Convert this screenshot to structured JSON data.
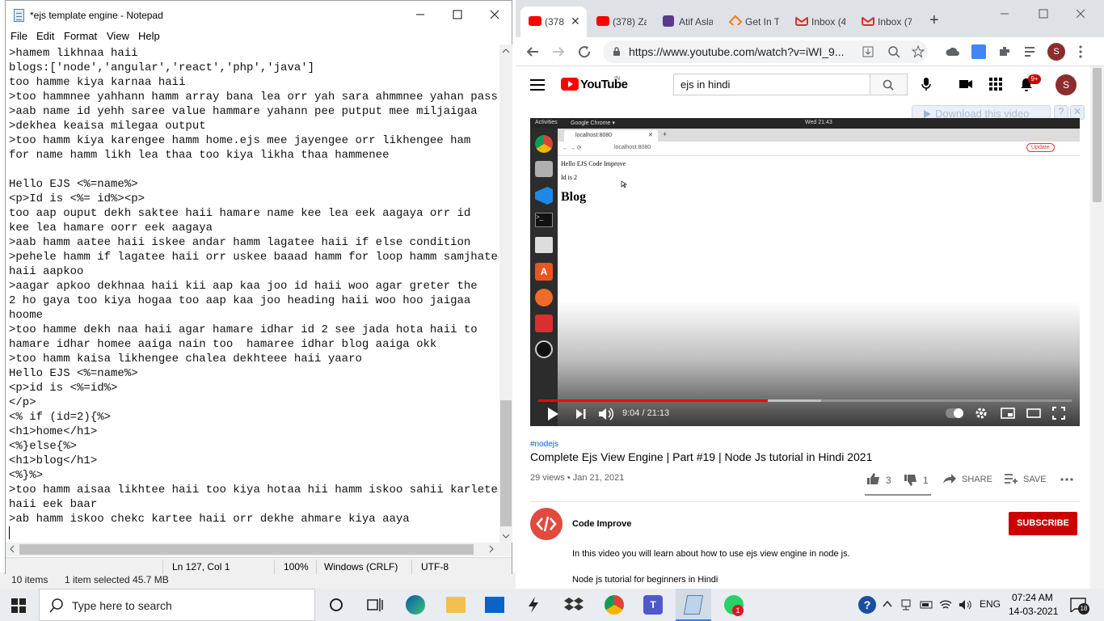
{
  "explorer": {
    "items": "10 items",
    "selected": "1 item selected  45.7 MB"
  },
  "notepad": {
    "title": "*ejs template engine - Notepad",
    "menu": [
      "File",
      "Edit",
      "Format",
      "View",
      "Help"
    ],
    "lines": [
      ">hamem likhnaa haii",
      "blogs:['node','angular','react','php','java']",
      "too hamme kiya karnaa haii",
      ">too hammnee yahhann hamm array bana lea orr yah sara ahmmnee yahan passkari",
      ">aab name id yehh saree value hammare yahann pee putput mee miljaigaa",
      ">dekhea keaisa milegaa output",
      ">too hamm kiya karengee hamm home.ejs mee jayengee orr likhengee ham",
      "for name hamm likh lea thaa too kiya likha thaa hammenee",
      "",
      "Hello EJS <%=name%>",
      "<p>Id is <%= id%><p>",
      "too aap ouput dekh saktee haii hamare name kee lea eek aagaya orr id",
      "kee lea hamare oorr eek aagaya",
      ">aab hamm aatee haii iskee andar hamm lagatee haii if else condition",
      ">pehele hamm if lagatee haii orr uskee baaad hamm for loop hamm samjhatee",
      "haii aapkoo",
      ">aagar apkoo dekhnaa haii kii aap kaa joo id haii woo agar greter the",
      "2 ho gaya too kiya hogaa too aap kaa joo heading haii woo hoo jaigaa",
      "hoome",
      ">too hamme dekh naa haii agar hamare idhar id 2 see jada hota haii to",
      "hamare idhar homee aaiga nain too  hamaree idhar blog aaiga okk",
      ">too hamm kaisa likhengee chalea dekhteee haii yaaro",
      "Hello EJS <%=name%>",
      "<p>id is <%=id%>",
      "</p>",
      "<% if (id=2){%>",
      "<h1>home</h1>",
      "<%}else{%>",
      "<h1>blog</h1>",
      "<%}%>",
      ">too hamm aisaa likhtee haii too kiya hotaa hii hamm iskoo sahii karlete",
      "haii eek baar",
      ">ab hamm iskoo chekc kartee haii orr dekhe ahmare kiya aaya",
      ""
    ],
    "status": {
      "position": "Ln 127, Col 1",
      "zoom": "100%",
      "eol": "Windows (CRLF)",
      "encoding": "UTF-8"
    }
  },
  "chrome": {
    "tabs": [
      "(378",
      "(378) Za",
      "Atif Asla",
      "Get In T",
      "Inbox (4",
      "Inbox (7"
    ],
    "url": "https://www.youtube.com/watch?v=iWI_9...",
    "profile": "S"
  },
  "youtube": {
    "logo": "YouTube",
    "logo_sup": "IN",
    "search_value": "ejs in hindi",
    "notif_count": "9+",
    "avatar": "S",
    "download_label": "Download this video",
    "video": {
      "ubuntu_top": "Activities",
      "ubuntu_app": "Google Chrome ▾",
      "ubuntu_clock": "Wed 21:43",
      "inner_tab": "localhost:8080",
      "inner_url": "localhost:8080",
      "inner_update": "Update",
      "page_line1": "Hello EJS Code Improve",
      "page_line2": "Id is 2",
      "page_heading": "Blog",
      "time": "9:04 / 21:13",
      "progress": 0.43,
      "buffered": 0.53
    },
    "hashtag": "#nodejs",
    "title": "Complete Ejs View Engine | Part #19 | Node Js tutorial in Hindi 2021",
    "meta": "29 views • Jan 21, 2021",
    "likes": "3",
    "dislikes": "1",
    "share": "SHARE",
    "save": "SAVE",
    "channel": "Code Improve",
    "subscribe": "SUBSCRIBE",
    "desc1": "In this video you will learn about how to use ejs view engine in node js.",
    "desc2": "Node js tutorial for beginners in Hindi"
  },
  "taskbar": {
    "search": "Type here to search",
    "lang": "ENG",
    "time": "07:24 AM",
    "date": "14-03-2021",
    "notif": "18",
    "whatsapp_badge": "1"
  },
  "colors": {
    "yt_red": "#ff0000",
    "subscribe": "#cc0000",
    "progress": "#ff0000"
  }
}
